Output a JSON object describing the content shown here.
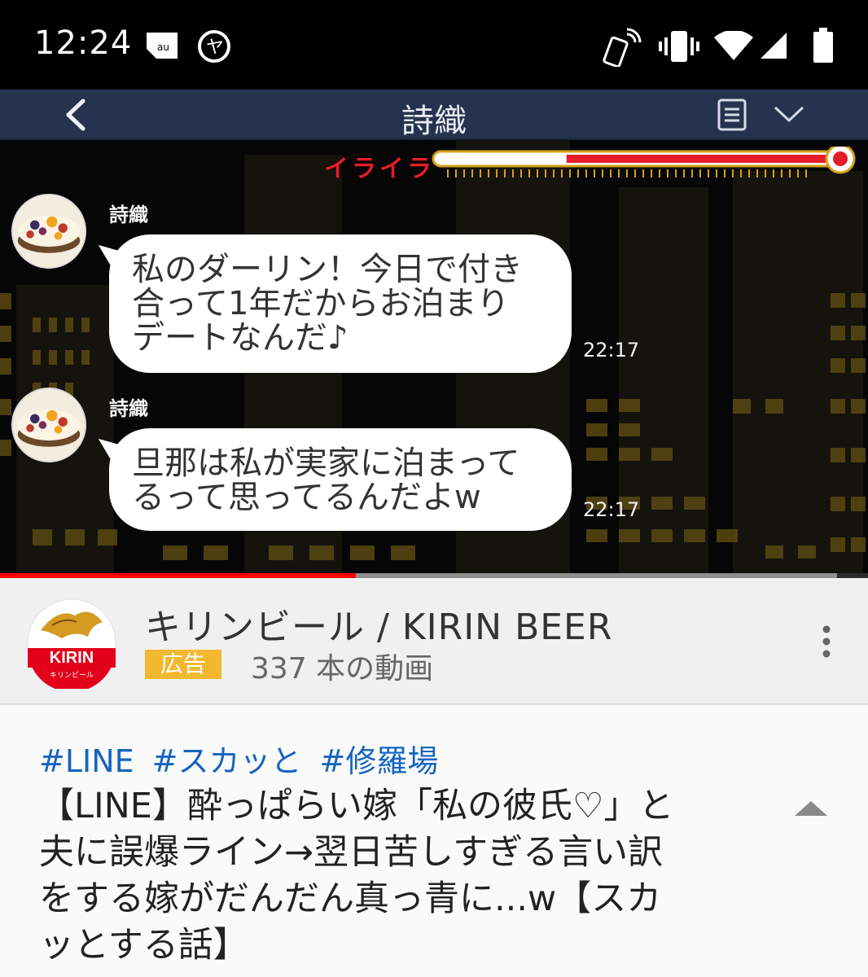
{
  "status_bar": {
    "time": "12:24",
    "left_icons": [
      "au-logo-icon",
      "ya-circle-icon"
    ],
    "right_icons": [
      "phone-ringing-icon",
      "vibrate-icon",
      "wifi-icon",
      "cell-signal-icon",
      "battery-icon"
    ]
  },
  "video": {
    "chat_header": {
      "title": "詩織",
      "icons": [
        "back-icon",
        "menu-icon",
        "chevron-down-icon"
      ]
    },
    "irritation_meter": {
      "label": "イライラ",
      "level": 0.67,
      "color": "#e51d28"
    },
    "messages": [
      {
        "sender": "詩織",
        "lines": [
          "私のダーリン！今日で付き",
          "合って1年だからお泊まり",
          "デートなんだ♪"
        ],
        "time": "22:17"
      },
      {
        "sender": "詩織",
        "lines": [
          "旦那は私が実家に泊まって",
          "るって思ってるんだよw"
        ],
        "time": "22:17"
      }
    ],
    "progress": {
      "played": 0.41,
      "color": "#ff0000"
    }
  },
  "channel": {
    "name": "キリンビール / KIRIN BEER",
    "ad_badge": "広告",
    "video_count": "337 本の動画",
    "logo_text": "KIRIN",
    "logo_subtext": "キリンビール",
    "ad_color": "#f2b82f"
  },
  "description": {
    "hashtags": [
      "#LINE",
      "#スカッと",
      "#修羅場"
    ],
    "title_lines": [
      "【LINE】酔っぱらい嫁「私の彼氏♡」と",
      "夫に誤爆ライン→翌日苦しすぎる言い訳",
      "をする嫁がだんだん真っ青に...w【スカ",
      "ッとする話】"
    ],
    "hashtag_color": "#1565c0"
  }
}
